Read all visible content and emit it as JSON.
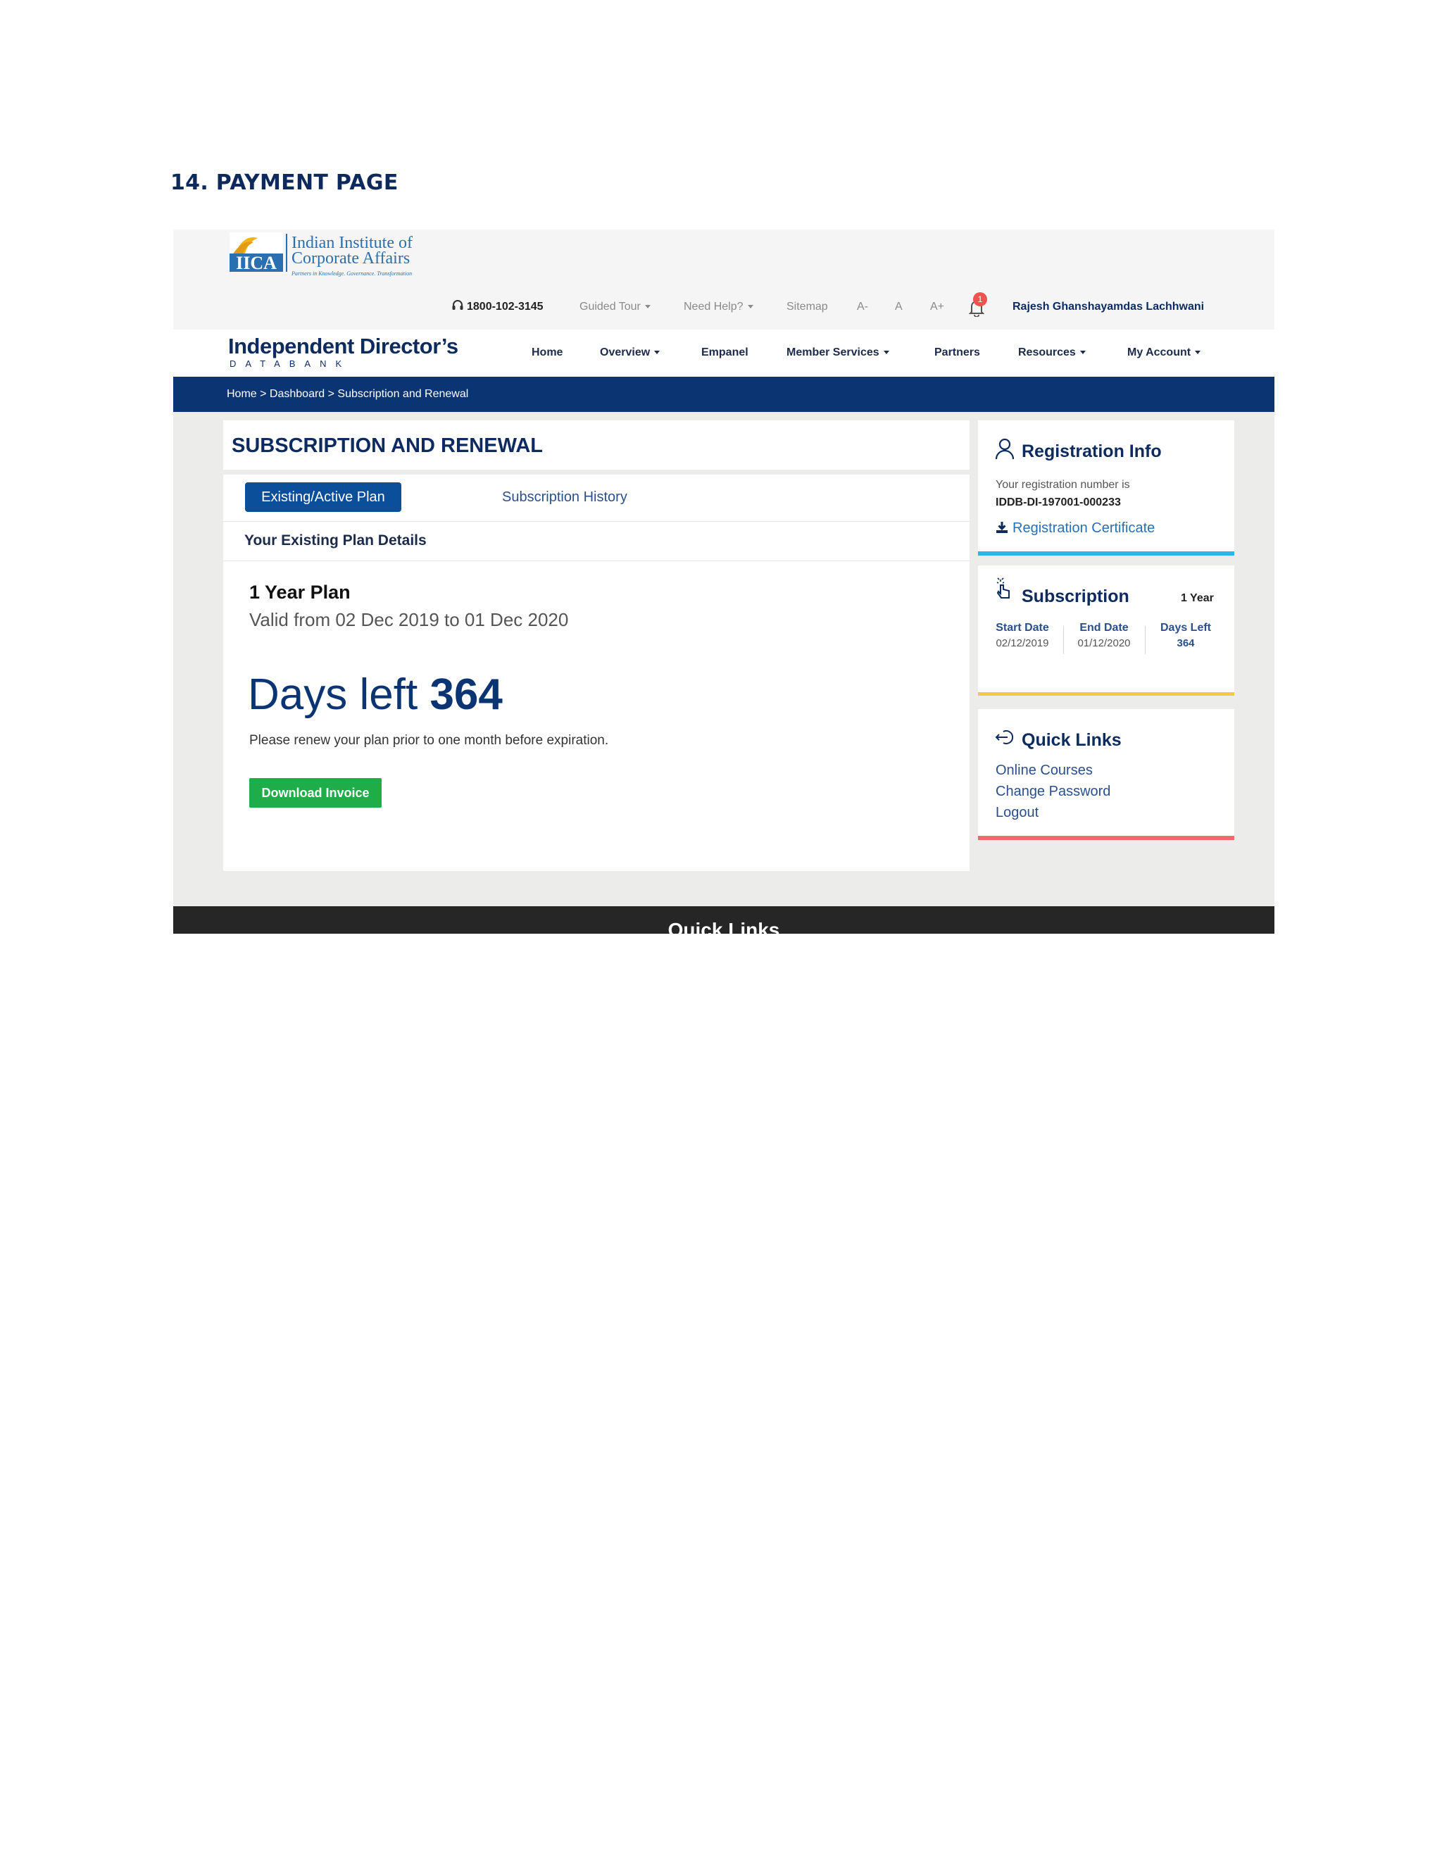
{
  "document": {
    "heading": "14. PAYMENT PAGE"
  },
  "logo": {
    "mark": "IICA",
    "name_line1": "Indian Institute of",
    "name_line2": "Corporate Affairs",
    "tagline": "Partners in Knowledge. Governance. Transformation"
  },
  "utility_bar": {
    "phone": "1800-102-3145",
    "guided_tour": "Guided Tour",
    "need_help": "Need Help?",
    "sitemap": "Sitemap",
    "font_decrease": "A-",
    "font_normal": "A",
    "font_increase": "A+",
    "notification_count": "1",
    "user_name": "Rajesh Ghanshayamdas Lachhwani"
  },
  "brand": {
    "title": "Independent Director’s",
    "subtitle": "DATABANK"
  },
  "nav": {
    "items": [
      {
        "label": "Home"
      },
      {
        "label": "Overview"
      },
      {
        "label": "Empanel"
      },
      {
        "label": "Member Services"
      },
      {
        "label": "Partners"
      },
      {
        "label": "Resources"
      },
      {
        "label": "My Account"
      }
    ]
  },
  "breadcrumb": "Home > Dashboard > Subscription and Renewal",
  "main": {
    "title": "SUBSCRIPTION AND RENEWAL",
    "tabs": [
      {
        "label": "Existing/Active Plan"
      },
      {
        "label": "Subscription History"
      }
    ],
    "section_title": "Your Existing Plan Details",
    "plan_name": "1 Year Plan",
    "plan_validity": "Valid from 02 Dec 2019 to 01 Dec 2020",
    "days_left_label": "Days left",
    "days_left_value": "364",
    "renew_note": "Please renew your plan prior to one month before expiration.",
    "download_button": "Download Invoice"
  },
  "registration_card": {
    "title": "Registration Info",
    "label": "Your registration number is",
    "number": "IDDB-DI-197001-000233",
    "certificate_link": "Registration Certificate",
    "accent_color": "#29b6e8"
  },
  "subscription_card": {
    "title": "Subscription",
    "duration": "1 Year",
    "start_label": "Start Date",
    "start_value": "02/12/2019",
    "end_label": "End Date",
    "end_value": "01/12/2020",
    "days_label": "Days Left",
    "days_value": "364",
    "accent_color": "#f5c74a"
  },
  "quick_links_card": {
    "title": "Quick Links",
    "links": [
      {
        "label": "Online Courses"
      },
      {
        "label": "Change Password"
      },
      {
        "label": "Logout"
      }
    ],
    "accent_color": "#ef6a6a"
  },
  "footer": {
    "title": "Quick Links"
  },
  "icons": {
    "phone": "headset-icon",
    "notification": "bell-icon",
    "registration": "user-icon",
    "certificate": "download-icon",
    "subscription": "touch-icon",
    "quick_links": "logout-icon"
  },
  "colors": {
    "primary": "#0b3472",
    "brand": "#0d2b5e",
    "success": "#1fad4a"
  }
}
